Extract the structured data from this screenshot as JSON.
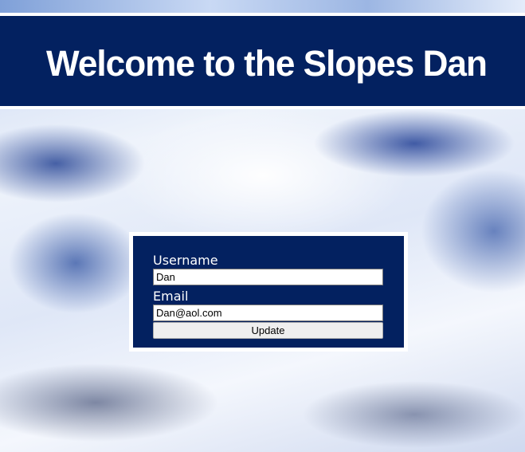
{
  "header": {
    "title": "Welcome to the Slopes Dan"
  },
  "form": {
    "username_label": "Username",
    "username_value": "Dan",
    "email_label": "Email",
    "email_value": "Dan@aol.com",
    "update_label": "Update"
  },
  "colors": {
    "navy": "#032160",
    "white": "#ffffff",
    "button": "#efefef"
  }
}
